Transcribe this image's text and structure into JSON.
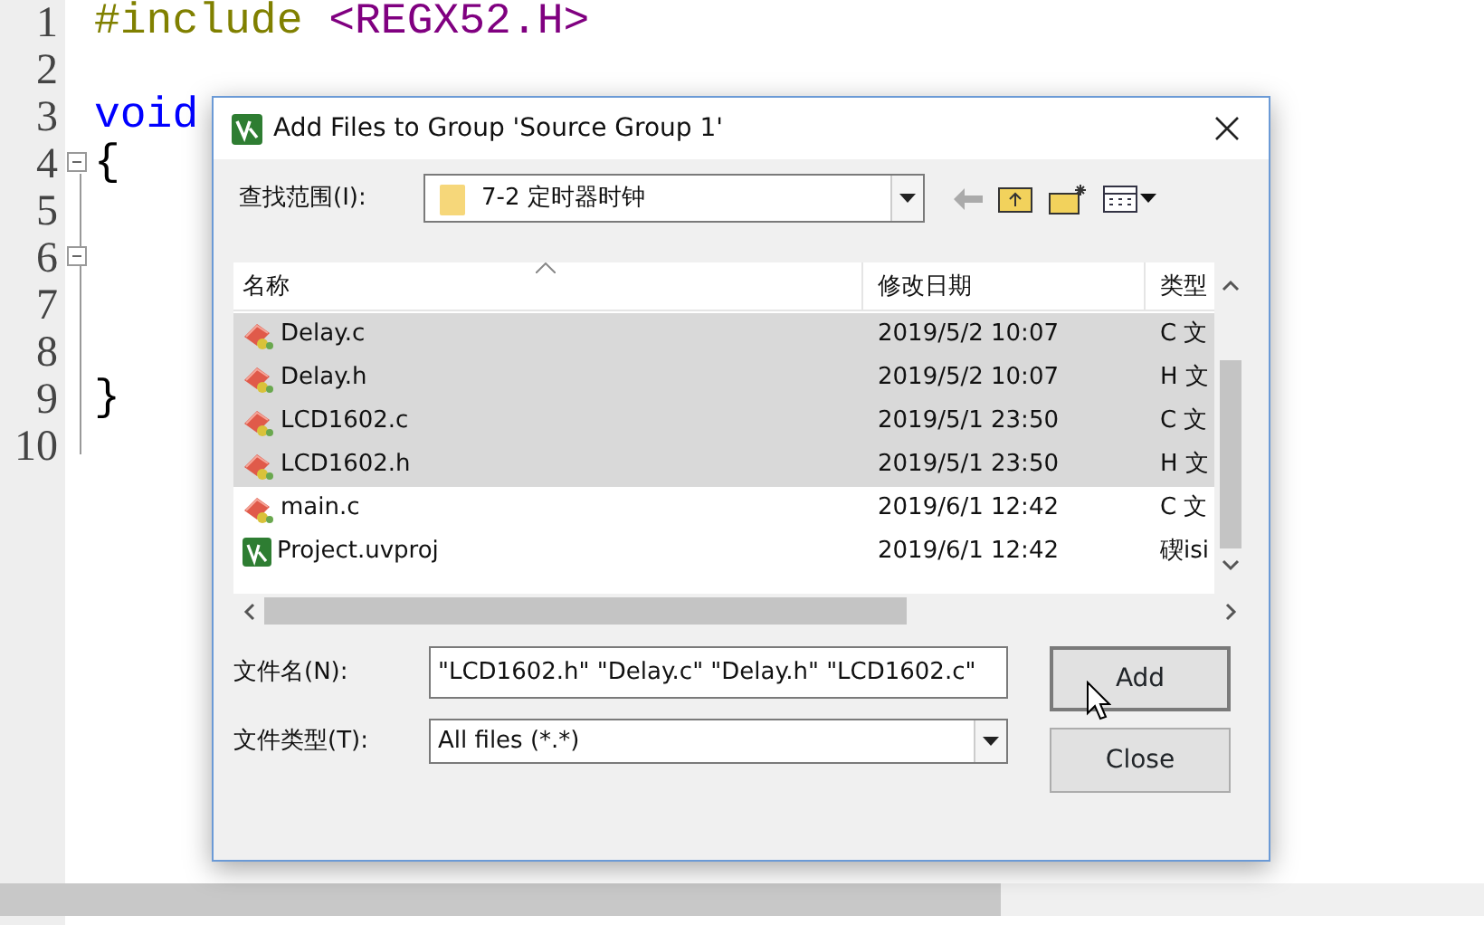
{
  "editor": {
    "lines": [
      {
        "number": "1",
        "fold_box": false,
        "tokens": [
          {
            "text": "#include",
            "color": "#808000"
          },
          {
            "text": " <REGX52.H>",
            "color": "#800080"
          }
        ]
      },
      {
        "number": "2",
        "fold_box": false
      },
      {
        "number": "3",
        "fold_box": false,
        "tokens": [
          {
            "text": "void",
            "color": "#0000ff"
          }
        ]
      },
      {
        "number": "4",
        "fold_box": true,
        "tokens": [
          {
            "text": "{",
            "color": "#000000"
          }
        ]
      },
      {
        "number": "5",
        "fold_box": false
      },
      {
        "number": "6",
        "fold_box": true
      },
      {
        "number": "7",
        "fold_box": false
      },
      {
        "number": "8",
        "fold_box": false
      },
      {
        "number": "9",
        "fold_box": false,
        "tokens": [
          {
            "text": "}",
            "color": "#000000"
          }
        ]
      },
      {
        "number": "10",
        "fold_box": false
      }
    ]
  },
  "dialog": {
    "title": "Add Files to Group 'Source Group 1'",
    "look_in": {
      "label": "查找范围(I):",
      "value": "7-2 定时器时钟"
    },
    "columns": [
      "名称",
      "修改日期",
      "类型"
    ],
    "files": [
      {
        "name": "Delay.c",
        "date": "2019/5/2 10:07",
        "type": "C 文",
        "kind": "source",
        "selected": true
      },
      {
        "name": "Delay.h",
        "date": "2019/5/2 10:07",
        "type": "H 文",
        "kind": "source",
        "selected": true
      },
      {
        "name": "LCD1602.c",
        "date": "2019/5/1 23:50",
        "type": "C 文",
        "kind": "source",
        "selected": true
      },
      {
        "name": "LCD1602.h",
        "date": "2019/5/1 23:50",
        "type": "H 文",
        "kind": "source",
        "selected": true
      },
      {
        "name": "main.c",
        "date": "2019/6/1 12:42",
        "type": "C 文",
        "kind": "source",
        "selected": false
      },
      {
        "name": "Project.uvproj",
        "date": "2019/6/1 12:42",
        "type": "碶isi",
        "kind": "project",
        "selected": false
      }
    ],
    "file_name": {
      "label": "文件名(N):",
      "value": "\"LCD1602.h\" \"Delay.c\" \"Delay.h\" \"LCD1602.c\""
    },
    "file_type": {
      "label": "文件类型(T):",
      "value": "All files (*.*)"
    },
    "buttons": [
      "Add",
      "Close"
    ]
  }
}
